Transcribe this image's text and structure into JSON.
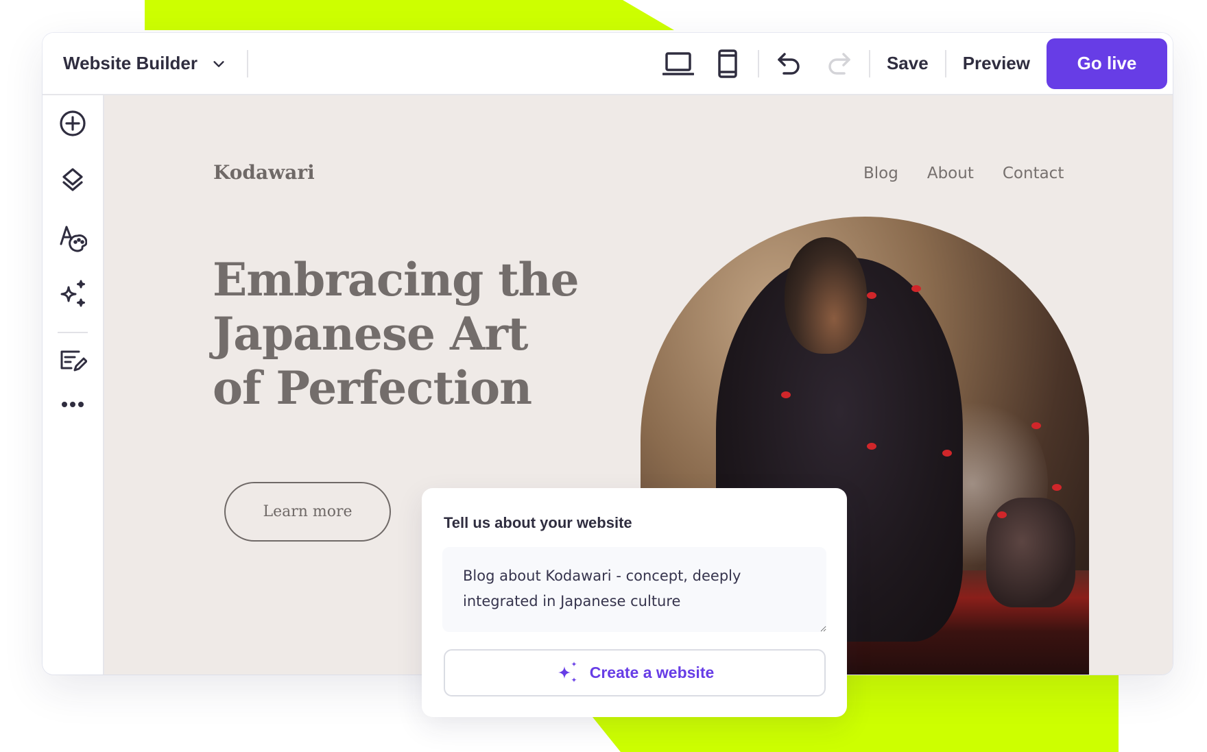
{
  "toolbar": {
    "app_title": "Website Builder",
    "dropdown_icon": "chevron-down-icon",
    "device_desktop_icon": "laptop-icon",
    "device_mobile_icon": "mobile-icon",
    "undo_icon": "undo-icon",
    "redo_icon": "redo-icon",
    "save_label": "Save",
    "preview_label": "Preview",
    "go_live_label": "Go live",
    "accent_color": "#673de6"
  },
  "sidebar": {
    "items": [
      {
        "icon": "add-circle-icon",
        "label": "Add element"
      },
      {
        "icon": "layers-icon",
        "label": "Layers"
      },
      {
        "icon": "styles-palette-icon",
        "label": "Styles"
      },
      {
        "icon": "ai-sparkles-icon",
        "label": "AI tools"
      },
      {
        "icon": "edit-text-icon",
        "label": "Edit content"
      },
      {
        "icon": "more-dots-icon",
        "label": "More"
      }
    ]
  },
  "site": {
    "logo": "Kodawari",
    "nav": [
      "Blog",
      "About",
      "Contact"
    ],
    "hero_title_lines": [
      "Embracing the",
      "Japanese Art",
      "of Perfection"
    ],
    "cta_label": "Learn more",
    "hero_image": "samurai-tea-ceremony-painting"
  },
  "prompt_card": {
    "label": "Tell us about your website",
    "textarea_value": "Blog about Kodawari - concept, deeply integrated in Japanese culture",
    "button_label": "Create a website",
    "button_icon": "ai-sparkles-icon"
  },
  "colors": {
    "lime_accent": "#cdff00",
    "canvas_bg": "#efeae7",
    "text_dark": "#2f2d3f"
  }
}
